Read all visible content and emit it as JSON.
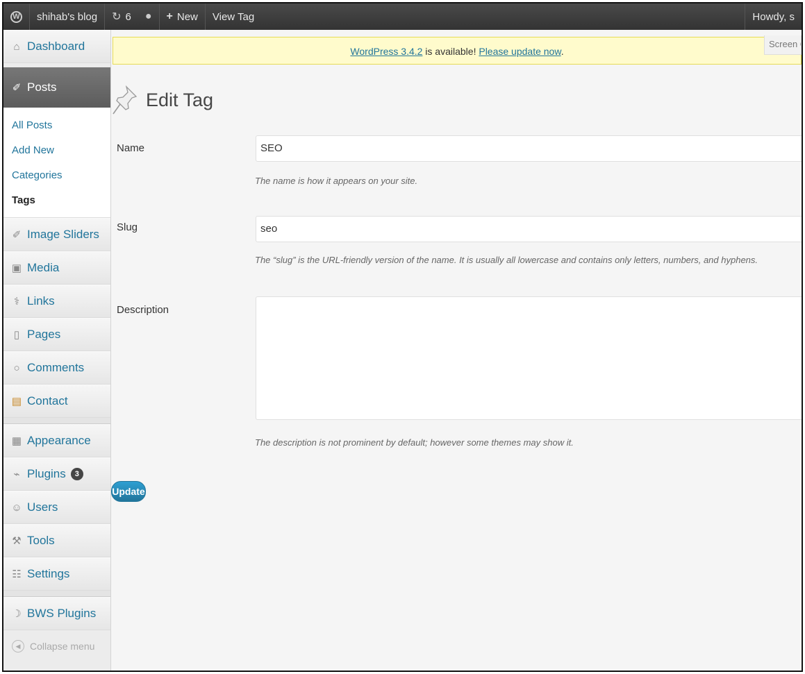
{
  "adminbar": {
    "site_name": "shihab's blog",
    "updates_count": "6",
    "new_label": "New",
    "view_label": "View Tag",
    "howdy": "Howdy, s"
  },
  "sidebar": {
    "dashboard": "Dashboard",
    "posts": "Posts",
    "posts_sub": [
      "All Posts",
      "Add New",
      "Categories",
      "Tags"
    ],
    "image_sliders": "Image Sliders",
    "media": "Media",
    "links": "Links",
    "pages": "Pages",
    "comments": "Comments",
    "contact": "Contact",
    "appearance": "Appearance",
    "plugins": "Plugins",
    "plugins_badge": "3",
    "users": "Users",
    "tools": "Tools",
    "settings": "Settings",
    "bws_plugins": "BWS Plugins",
    "collapse": "Collapse menu"
  },
  "notice": {
    "version_link": "WordPress 3.4.2",
    "text": " is available! ",
    "update_link": "Please update now",
    "end": "."
  },
  "screen_options": "Screen Op",
  "page_title": "Edit Tag",
  "form": {
    "name_label": "Name",
    "name_value": "SEO",
    "name_desc": "The name is how it appears on your site.",
    "slug_label": "Slug",
    "slug_value": "seo",
    "slug_desc": "The “slug” is the URL-friendly version of the name. It is usually all lowercase and contains only letters, numbers, and hyphens.",
    "description_label": "Description",
    "description_value": "",
    "description_desc": "The description is not prominent by default; however some themes may show it.",
    "update_button": "Update"
  }
}
